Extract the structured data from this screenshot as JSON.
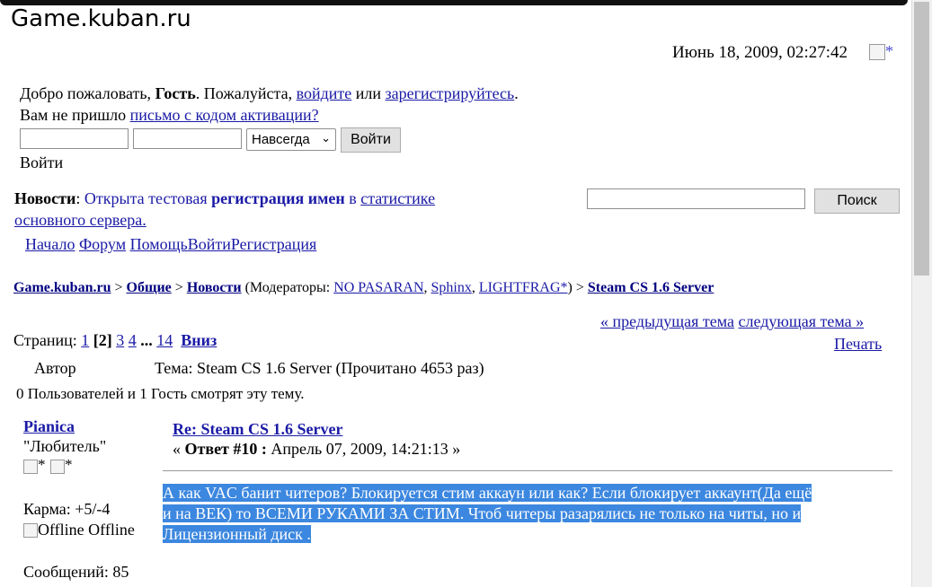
{
  "site_title": "Game.kuban.ru",
  "datetime": "Июнь 18, 2009, 02:27:42",
  "broken_img_alt": "*",
  "welcome": {
    "prefix": "Добро пожаловать,",
    "guest": "Гость",
    "please": ". Пожалуйста,",
    "login_link": "войдите",
    "or": "или",
    "register_link": "зарегистрируйтесь",
    "dot": ".",
    "no_letter": "Вам не пришло",
    "activation_link": "письмо с кодом активации?"
  },
  "login": {
    "duration": "Навсегда",
    "button": "Войти",
    "label": "Войти"
  },
  "news": {
    "label": "Новости",
    "colon": ":",
    "text1": "Открыта тестовая",
    "bold1": "регистрация имен",
    "text2": "в",
    "link": "статистике",
    "line2": "основного сервера."
  },
  "search": {
    "button": "Поиск"
  },
  "menu": [
    "Начало",
    "Форум",
    "Помощь",
    "Войти",
    "Регистрация"
  ],
  "breadcrumb": {
    "home": "Game.kuban.ru",
    "sep": ">",
    "cat": "Общие",
    "board": "Новости",
    "mods_label": "(Модераторы:",
    "mods": [
      "NO PASARAN",
      "Sphinx",
      "LIGHTFRAG*"
    ],
    "close": ")",
    "topic": "Steam CS 1.6 Server"
  },
  "prevnext": {
    "prev": "« предыдущая тема",
    "next": "следующая тема »"
  },
  "pages": {
    "label": "Страниц:",
    "p1": "1",
    "current": "[2]",
    "p3": "3",
    "p4": "4",
    "dots": "...",
    "p14": "14",
    "down": "Вниз"
  },
  "print": "Печать",
  "header": {
    "author": "Автор",
    "topic": "Тема: Steam CS 1.6 Server  (Прочитано 4653 раз)"
  },
  "viewers": "0 Пользователей и 1 Гость смотрят эту тему.",
  "poster": {
    "name": "Pianica",
    "rank": "\"Любитель\"",
    "star_alt": "*",
    "karma": "Карма: +5/-4",
    "offline": "Offline Offline",
    "posts": "Сообщений: 85"
  },
  "post": {
    "title": "Re: Steam CS 1.6 Server",
    "open": "«",
    "reply": "Ответ #10 :",
    "date": "Апрель 07, 2009, 14:21:13",
    "close": "»",
    "body_line1": "А как VAC банит читеров?  Блокируется стим аккаун или как? Если блокирует аккаунт(Да ещё",
    "body_line2": "и на ВЕК) то ВСЕМИ РУКАМИ ЗА СТИМ. Чтоб читеры разарялись не только на читы, но и",
    "body_line3": "Лицензионный диск ."
  },
  "colors": {
    "link": "#1a1aa6",
    "selection": "#3c87df"
  }
}
